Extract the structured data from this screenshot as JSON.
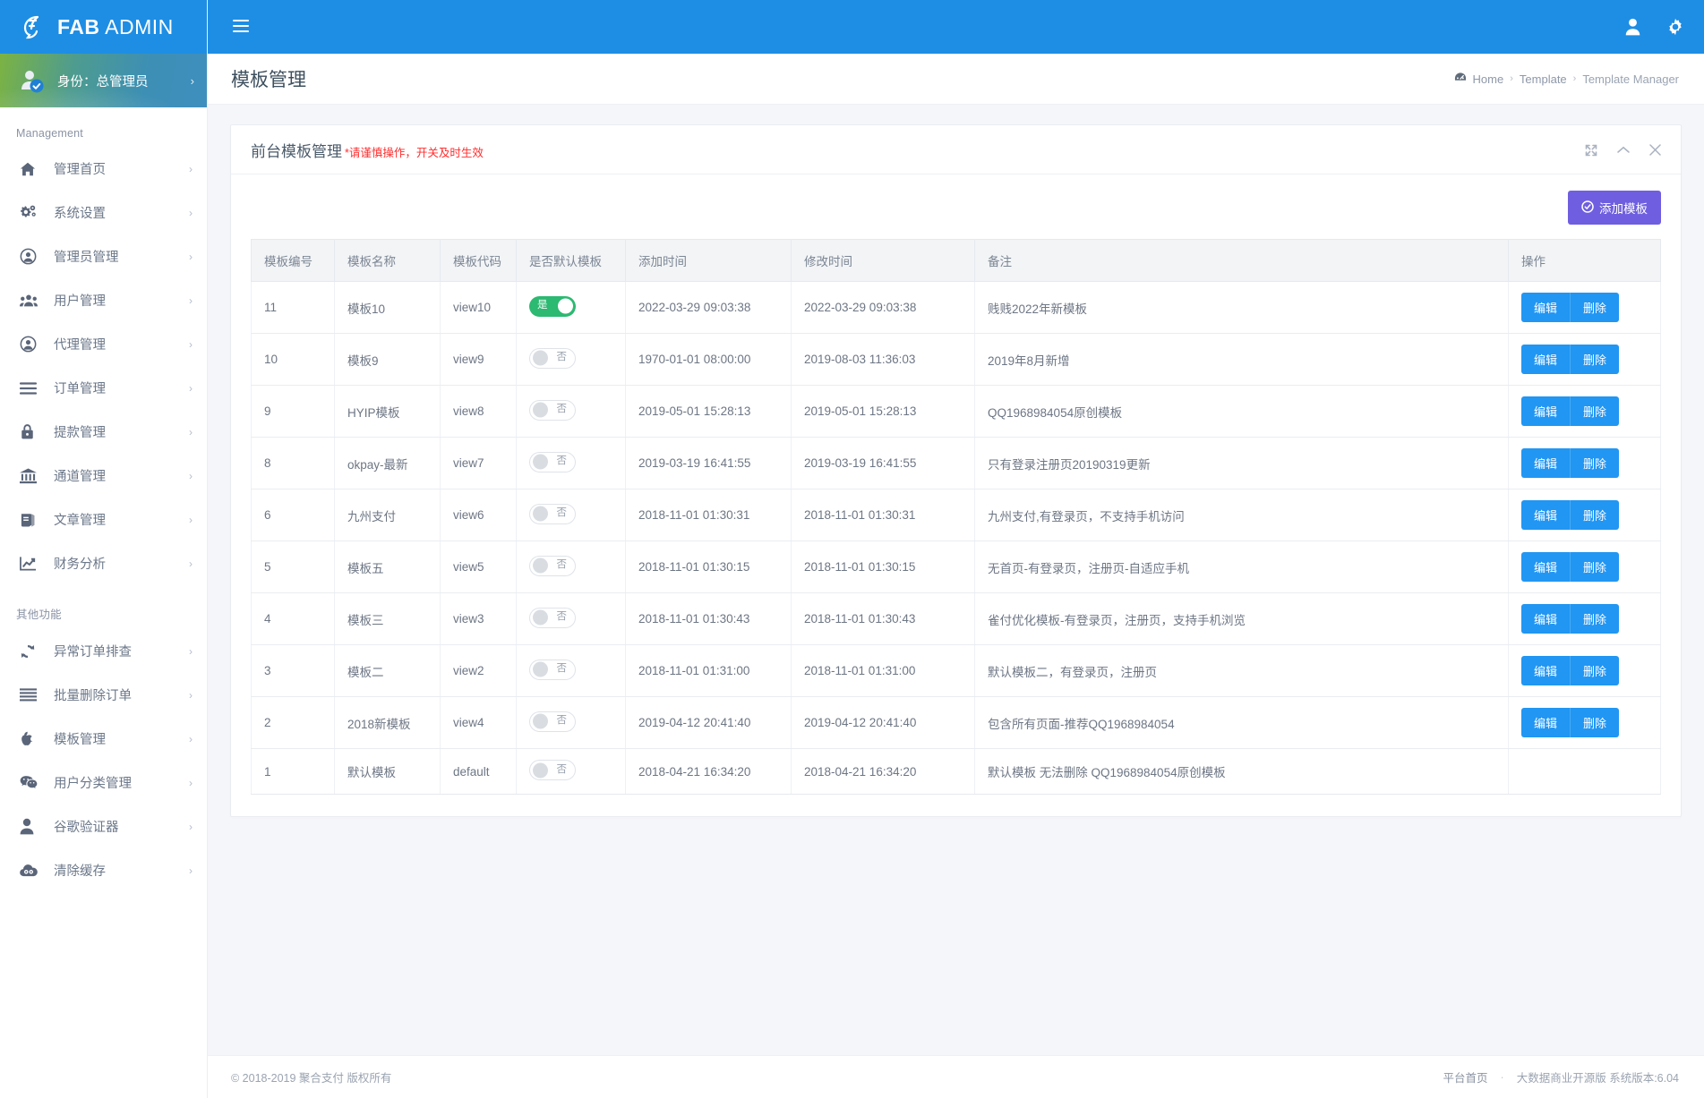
{
  "brand": {
    "bold": "FAB",
    "light": "ADMIN"
  },
  "profile": {
    "label": "身份：总管理员",
    "arrow": "›"
  },
  "topbar": {
    "menu_icon": "hamburger-icon",
    "user_icon": "user-icon",
    "gear_icon": "gear-icon"
  },
  "page": {
    "title": "模板管理"
  },
  "breadcrumb": {
    "home": "Home",
    "sep": "›",
    "level1": "Template",
    "level2": "Template Manager"
  },
  "sidebar": {
    "section1": "Management",
    "section2": "其他功能",
    "arrow": "›",
    "group1": [
      {
        "label": "管理首页",
        "icon": "home-icon"
      },
      {
        "label": "系统设置",
        "icon": "gears-icon"
      },
      {
        "label": "管理员管理",
        "icon": "user-circle-icon"
      },
      {
        "label": "用户管理",
        "icon": "users-icon"
      },
      {
        "label": "代理管理",
        "icon": "user-circle-icon"
      },
      {
        "label": "订单管理",
        "icon": "list-icon"
      },
      {
        "label": "提款管理",
        "icon": "lock-icon"
      },
      {
        "label": "通道管理",
        "icon": "bank-icon"
      },
      {
        "label": "文章管理",
        "icon": "book-icon"
      },
      {
        "label": "财务分析",
        "icon": "chart-line-icon"
      }
    ],
    "group2": [
      {
        "label": "异常订单排查",
        "icon": "refresh-icon"
      },
      {
        "label": "批量删除订单",
        "icon": "bars-icon"
      },
      {
        "label": "模板管理",
        "icon": "apple-icon"
      },
      {
        "label": "用户分类管理",
        "icon": "wechat-icon"
      },
      {
        "label": "谷歌验证器",
        "icon": "user-solid-icon"
      },
      {
        "label": "清除缓存",
        "icon": "cloud-icon"
      }
    ]
  },
  "panel": {
    "title": "前台模板管理",
    "warning": "*请谨慎操作，开关及时生效",
    "tools": {
      "expand": "expand-icon",
      "collapse": "chevron-up-icon",
      "close": "close-icon"
    },
    "add_button": "添加模板",
    "add_button_icon": "check-circle-icon"
  },
  "table": {
    "headers": [
      "模板编号",
      "模板名称",
      "模板代码",
      "是否默认模板",
      "添加时间",
      "修改时间",
      "备注",
      "操作"
    ],
    "toggle_on_label": "是",
    "toggle_off_label": "否",
    "edit_label": "编辑",
    "delete_label": "删除",
    "rows": [
      {
        "id": "11",
        "name": "模板10",
        "code": "view10",
        "is_default": true,
        "added": "2022-03-29 09:03:38",
        "modified": "2022-03-29 09:03:38",
        "note": "贱贱2022年新模板",
        "actions": true
      },
      {
        "id": "10",
        "name": "模板9",
        "code": "view9",
        "is_default": false,
        "added": "1970-01-01 08:00:00",
        "modified": "2019-08-03 11:36:03",
        "note": "2019年8月新增",
        "actions": true
      },
      {
        "id": "9",
        "name": "HYIP模板",
        "code": "view8",
        "is_default": false,
        "added": "2019-05-01 15:28:13",
        "modified": "2019-05-01 15:28:13",
        "note": "QQ1968984054原创模板",
        "actions": true
      },
      {
        "id": "8",
        "name": "okpay-最新",
        "code": "view7",
        "is_default": false,
        "added": "2019-03-19 16:41:55",
        "modified": "2019-03-19 16:41:55",
        "note": "只有登录注册页20190319更新",
        "actions": true
      },
      {
        "id": "6",
        "name": "九州支付",
        "code": "view6",
        "is_default": false,
        "added": "2018-11-01 01:30:31",
        "modified": "2018-11-01 01:30:31",
        "note": "九州支付,有登录页，不支持手机访问",
        "actions": true
      },
      {
        "id": "5",
        "name": "模板五",
        "code": "view5",
        "is_default": false,
        "added": "2018-11-01 01:30:15",
        "modified": "2018-11-01 01:30:15",
        "note": "无首页-有登录页，注册页-自适应手机",
        "actions": true
      },
      {
        "id": "4",
        "name": "模板三",
        "code": "view3",
        "is_default": false,
        "added": "2018-11-01 01:30:43",
        "modified": "2018-11-01 01:30:43",
        "note": "雀付优化模板-有登录页，注册页，支持手机浏览",
        "actions": true
      },
      {
        "id": "3",
        "name": "模板二",
        "code": "view2",
        "is_default": false,
        "added": "2018-11-01 01:31:00",
        "modified": "2018-11-01 01:31:00",
        "note": "默认模板二，有登录页，注册页",
        "actions": true
      },
      {
        "id": "2",
        "name": "2018新模板",
        "code": "view4",
        "is_default": false,
        "added": "2019-04-12 20:41:40",
        "modified": "2019-04-12 20:41:40",
        "note": "包含所有页面-推荐QQ1968984054",
        "actions": true
      },
      {
        "id": "1",
        "name": "默认模板",
        "code": "default",
        "is_default": false,
        "added": "2018-04-21 16:34:20",
        "modified": "2018-04-21 16:34:20",
        "note": "默认模板 无法删除 QQ1968984054原创模板",
        "actions": false
      }
    ]
  },
  "footer": {
    "copyright": "© 2018-2019 聚合支付 版权所有",
    "link": "平台首页",
    "dot": "·",
    "version": "大数据商业开源版 系统版本:6.04"
  },
  "colors": {
    "brand_blue": "#1e8ee4",
    "accent_purple": "#6f5fe0",
    "action_blue": "#2196f3",
    "toggle_green": "#2cb971",
    "warn_red": "#ff2d2d"
  }
}
